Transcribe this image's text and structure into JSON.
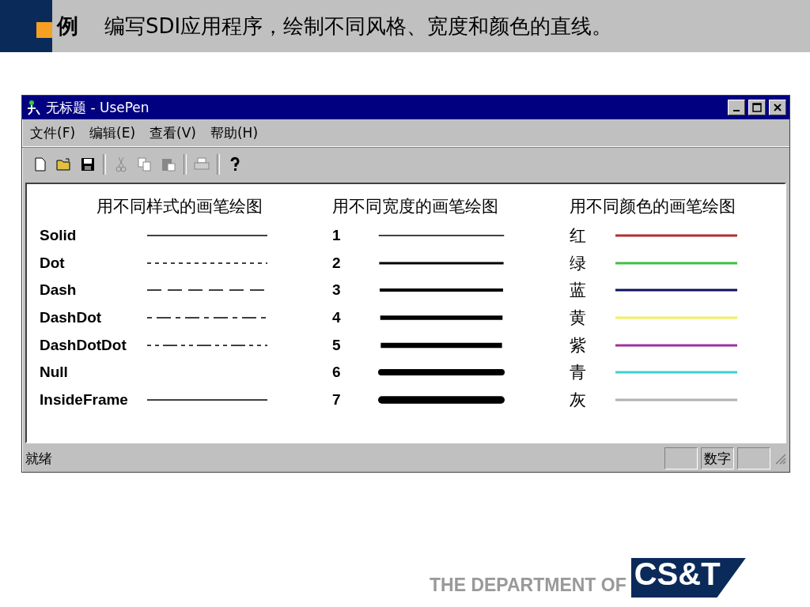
{
  "slide_header": {
    "marker": "例",
    "text": "编写SDI应用程序，绘制不同风格、宽度和颜色的直线。"
  },
  "window": {
    "title": "无标题 - UsePen",
    "menu": [
      {
        "label": "文件(F)"
      },
      {
        "label": "编辑(E)"
      },
      {
        "label": "查看(V)"
      },
      {
        "label": "帮助(H)"
      }
    ],
    "toolbar": [
      {
        "kind": "new",
        "disabled": false
      },
      {
        "kind": "open",
        "disabled": false
      },
      {
        "kind": "save",
        "disabled": false
      },
      {
        "kind": "separator"
      },
      {
        "kind": "cut",
        "disabled": true
      },
      {
        "kind": "copy",
        "disabled": true
      },
      {
        "kind": "paste",
        "disabled": true
      },
      {
        "kind": "separator"
      },
      {
        "kind": "print",
        "disabled": true
      },
      {
        "kind": "separator"
      },
      {
        "kind": "help",
        "disabled": false
      }
    ],
    "columns": [
      {
        "title": "用不同样式的画笔绘图",
        "rows": [
          {
            "label": "Solid",
            "kind": "solid"
          },
          {
            "label": "Dot",
            "kind": "dot"
          },
          {
            "label": "Dash",
            "kind": "dash"
          },
          {
            "label": "DashDot",
            "kind": "dashdot"
          },
          {
            "label": "DashDotDot",
            "kind": "dashdotdot"
          },
          {
            "label": "Null",
            "kind": "null"
          },
          {
            "label": "InsideFrame",
            "kind": "solid"
          }
        ]
      },
      {
        "title": "用不同宽度的画笔绘图",
        "rows": [
          {
            "label": "1",
            "kind": "width"
          },
          {
            "label": "2",
            "kind": "width"
          },
          {
            "label": "3",
            "kind": "width"
          },
          {
            "label": "4",
            "kind": "width"
          },
          {
            "label": "5",
            "kind": "width"
          },
          {
            "label": "6",
            "kind": "width"
          },
          {
            "label": "7",
            "kind": "width"
          }
        ]
      },
      {
        "title": "用不同颜色的画笔绘图",
        "rows": [
          {
            "label": "红",
            "kind": "color",
            "color": "#b03030"
          },
          {
            "label": "绿",
            "kind": "color",
            "color": "#40c040"
          },
          {
            "label": "蓝",
            "kind": "color",
            "color": "#101060"
          },
          {
            "label": "黄",
            "kind": "color",
            "color": "#f0f060"
          },
          {
            "label": "紫",
            "kind": "color",
            "color": "#a030a0"
          },
          {
            "label": "青",
            "kind": "color",
            "color": "#40d0d0"
          },
          {
            "label": "灰",
            "kind": "color",
            "color": "#b0b0b0"
          }
        ]
      }
    ],
    "status": {
      "text": "就绪",
      "panes": [
        {
          "kind": "empty"
        },
        {
          "kind": "text",
          "label": "数字"
        },
        {
          "kind": "empty"
        }
      ]
    }
  },
  "footer": {
    "text": "THE DEPARTMENT OF",
    "logo": "CS&T"
  }
}
